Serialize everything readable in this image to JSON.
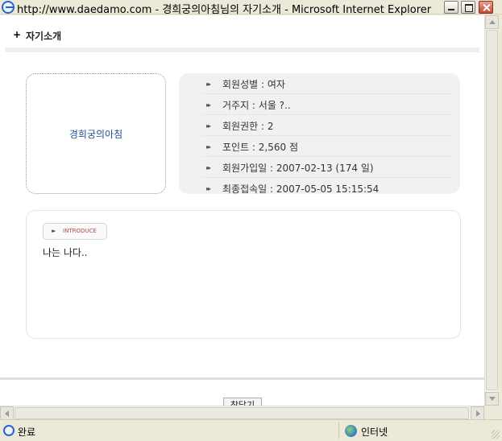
{
  "window": {
    "title": "http://www.daedamo.com - 경희궁의아침님의 자기소개 - Microsoft Internet Explorer"
  },
  "page": {
    "header_plus": "+",
    "header_title": "자기소개",
    "nickname": "경희궁의아침",
    "info_arrow": "▸▸",
    "info": [
      "회원성별 : 여자",
      "거주지 : 서울 ?..",
      "회원권한 : 2",
      "포인트 : 2,560 점",
      "회원가입일 : 2007-02-13 (174 일)",
      "최종접속일 : 2007-05-05 15:15:54"
    ],
    "intro_tab_label": "INTRODUCE",
    "intro_text": "나는 나다..",
    "close_button": "창닫기"
  },
  "statusbar": {
    "status": "완료",
    "zone": "인터넷"
  },
  "colors": {
    "nickname": "#1f4e8a",
    "intro_tab_label": "#b5464a",
    "info_bg": "#f1f1f1"
  }
}
